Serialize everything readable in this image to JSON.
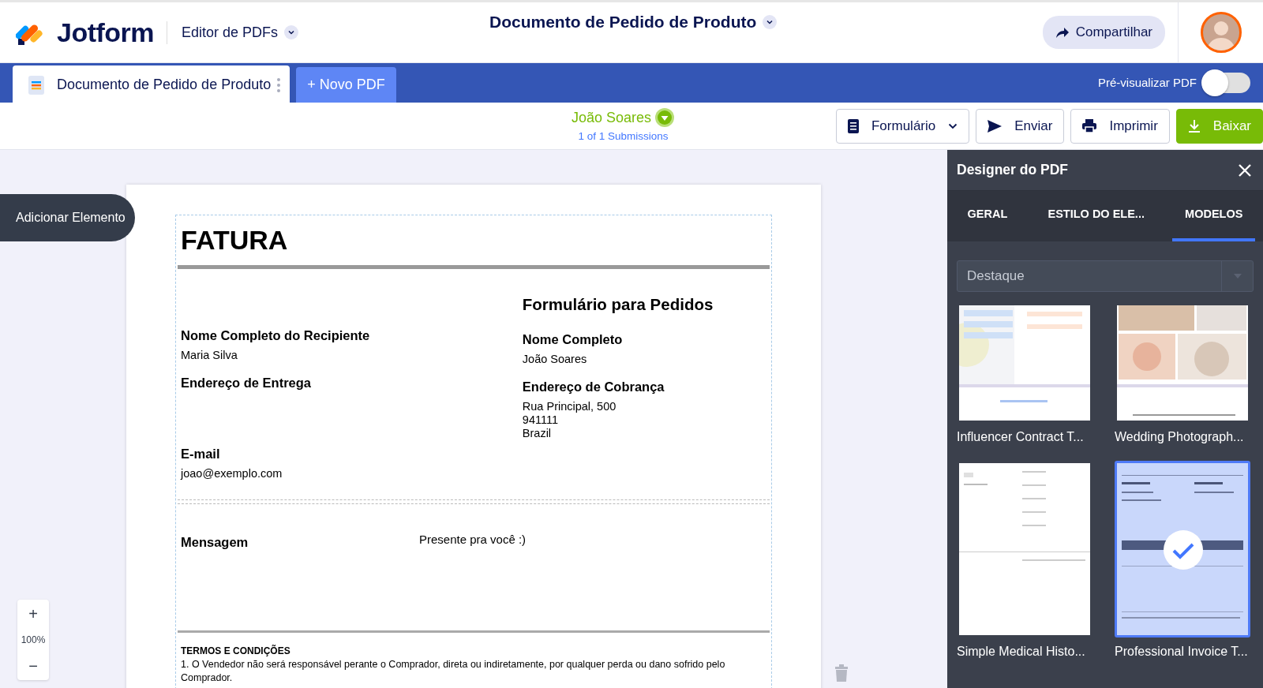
{
  "header": {
    "logo": "Jotform",
    "app_menu": "Editor de PDFs",
    "document_title": "Documento de Pedido de Produto",
    "share_button": "Compartilhar"
  },
  "tabs": [
    {
      "label": "Documento de Pedido de Produto",
      "kind": "document",
      "selected": true
    },
    {
      "label": "+ Novo PDF",
      "kind": "new",
      "selected": false
    }
  ],
  "preview_toggle": {
    "label": "Pré-visualizar PDF",
    "on": false
  },
  "submission": {
    "name": "João Soares",
    "count": "1 of 1 Submissions"
  },
  "toolbar_buttons": [
    {
      "label": "Formulário",
      "kind": "form"
    },
    {
      "label": "Enviar",
      "kind": "send"
    },
    {
      "label": "Imprimir",
      "kind": "print"
    },
    {
      "label": "Baixar",
      "kind": "download"
    }
  ],
  "add_element_button": "Adicionar Elemento",
  "zoom": {
    "zoom_in": "+",
    "level_text": "100%",
    "zoom_out": "−"
  },
  "document": {
    "title": "FATURA",
    "heading": "Formulário para Pedidos",
    "left_fields": [
      {
        "label": "Nome Completo do Recipiente",
        "value": [
          "Maria Silva"
        ]
      },
      {
        "label": "Endereço de Entrega"
      },
      {
        "label": "E-mail",
        "value": [
          "joao@exemplo.com"
        ]
      }
    ],
    "right_fields": [
      {
        "label": "Nome Completo",
        "value": [
          "João Soares"
        ]
      },
      {
        "label": "Endereço de Cobrança",
        "value": [
          "Rua Principal, 500",
          "941111",
          "Brazil"
        ]
      }
    ],
    "message_label": "Mensagem",
    "message_value": "Presente pra você :)",
    "terms_title": "TERMOS E CONDIÇÕES",
    "terms_text": "1. O Vendedor não será responsável perante o Comprador, direta ou indiretamente, por qualquer perda ou dano sofrido pelo Comprador."
  },
  "designer": {
    "title": "Designer do PDF",
    "tabs": [
      {
        "label": "GERAL",
        "selected": false
      },
      {
        "label": "ESTILO DO ELE...",
        "selected": false
      },
      {
        "label": "MODELOS",
        "selected": true
      }
    ],
    "select_value": "Destaque",
    "templates": [
      {
        "name": "Influencer Contract T...",
        "selected": false
      },
      {
        "name": "Wedding Photograph...",
        "selected": false
      },
      {
        "name": "Simple Medical Histo...",
        "selected": false
      },
      {
        "name": "Professional Invoice T...",
        "selected": true
      }
    ]
  }
}
